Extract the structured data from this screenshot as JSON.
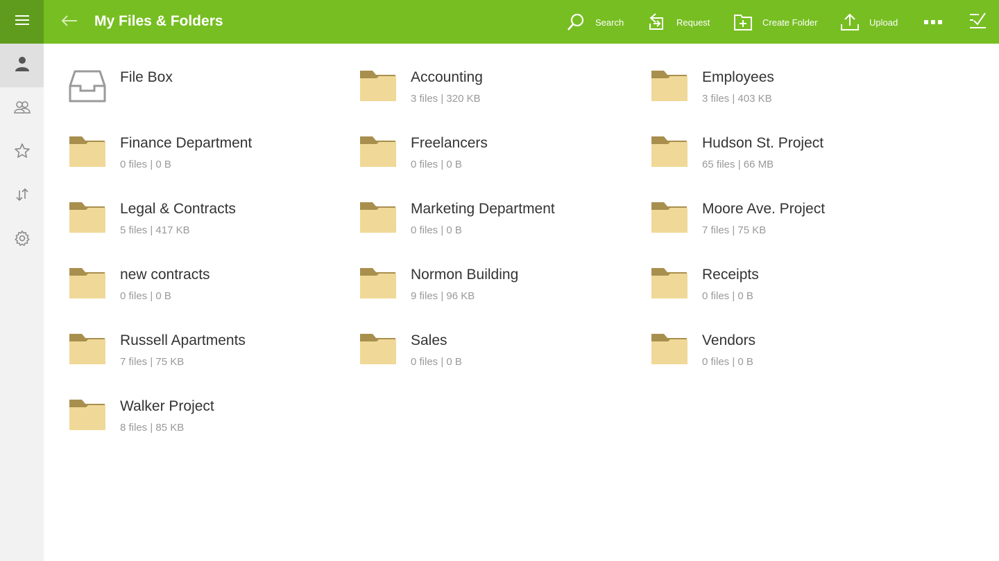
{
  "header": {
    "title": "My Files & Folders",
    "actions": {
      "search": "Search",
      "request": "Request",
      "create_folder": "Create Folder",
      "upload": "Upload"
    }
  },
  "colors": {
    "accent": "#77be22",
    "accent_dark": "#5f9c1d",
    "folder_back": "#a88f4e",
    "folder_front": "#f0d998"
  },
  "sidebar": {
    "items": [
      {
        "icon": "person-icon",
        "active": true
      },
      {
        "icon": "group-icon",
        "active": false
      },
      {
        "icon": "star-icon",
        "active": false
      },
      {
        "icon": "transfer-icon",
        "active": false
      },
      {
        "icon": "gear-icon",
        "active": false
      }
    ]
  },
  "items": [
    {
      "name": "File Box",
      "meta": "",
      "type": "filebox"
    },
    {
      "name": "Accounting",
      "meta": "3 files | 320 KB",
      "type": "folder"
    },
    {
      "name": "Employees",
      "meta": "3 files | 403 KB",
      "type": "folder"
    },
    {
      "name": "Finance Department",
      "meta": "0 files | 0 B",
      "type": "folder"
    },
    {
      "name": "Freelancers",
      "meta": "0 files | 0 B",
      "type": "folder"
    },
    {
      "name": "Hudson St. Project",
      "meta": "65 files | 66 MB",
      "type": "folder"
    },
    {
      "name": "Legal & Contracts",
      "meta": "5 files | 417 KB",
      "type": "folder"
    },
    {
      "name": "Marketing Department",
      "meta": "0 files | 0 B",
      "type": "folder"
    },
    {
      "name": "Moore Ave. Project",
      "meta": "7 files | 75 KB",
      "type": "folder"
    },
    {
      "name": "new contracts",
      "meta": "0 files | 0 B",
      "type": "folder"
    },
    {
      "name": "Normon Building",
      "meta": "9 files | 96 KB",
      "type": "folder"
    },
    {
      "name": "Receipts",
      "meta": "0 files | 0 B",
      "type": "folder"
    },
    {
      "name": "Russell Apartments",
      "meta": "7 files | 75 KB",
      "type": "folder"
    },
    {
      "name": "Sales",
      "meta": "0 files | 0 B",
      "type": "folder"
    },
    {
      "name": "Vendors",
      "meta": "0 files | 0 B",
      "type": "folder"
    },
    {
      "name": "Walker Project",
      "meta": "8 files | 85 KB",
      "type": "folder"
    }
  ]
}
